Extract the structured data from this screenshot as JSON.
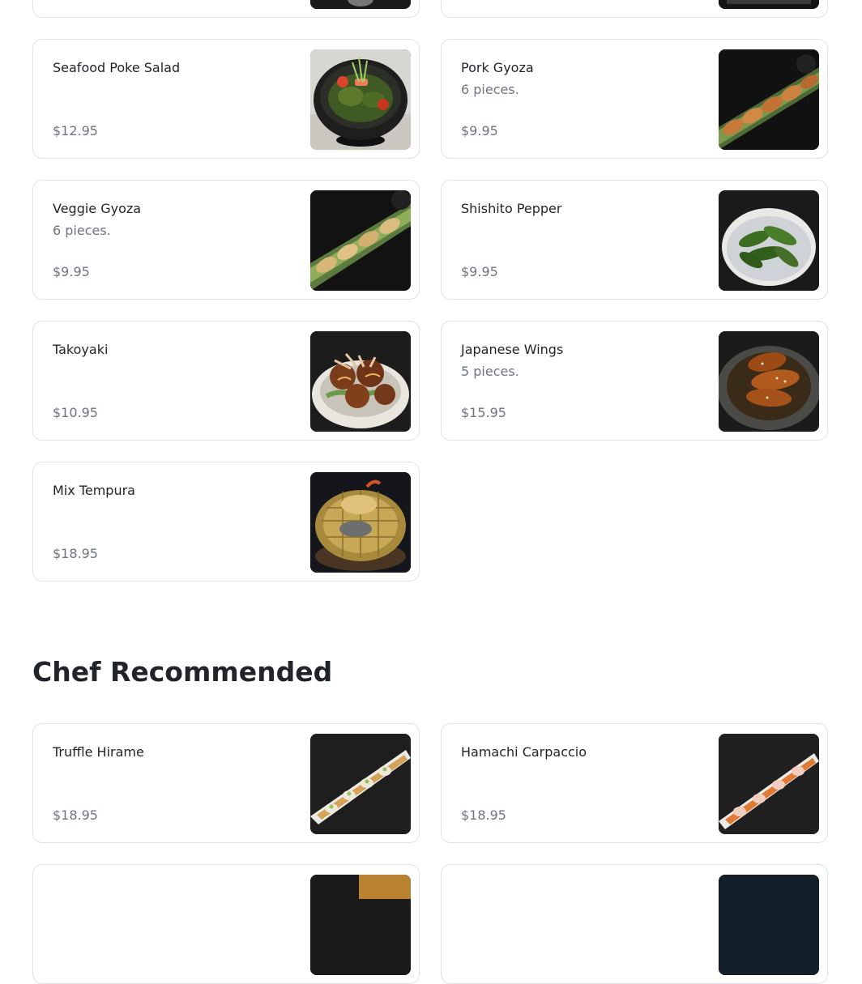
{
  "top_cards": [
    {
      "name": "",
      "price": ""
    },
    {
      "name": "",
      "price": ""
    }
  ],
  "previous_section": {
    "items": [
      {
        "name": "Seafood Poke Salad",
        "description": "",
        "price": "$12.95",
        "image": "poke-salad-photo"
      },
      {
        "name": "Pork Gyoza",
        "description": "6 pieces.",
        "price": "$9.95",
        "image": "pork-gyoza-photo"
      },
      {
        "name": "Veggie Gyoza",
        "description": "6 pieces.",
        "price": "$9.95",
        "image": "veggie-gyoza-photo"
      },
      {
        "name": "Shishito Pepper",
        "description": "",
        "price": "$9.95",
        "image": "shishito-pepper-photo"
      },
      {
        "name": "Takoyaki",
        "description": "",
        "price": "$10.95",
        "image": "takoyaki-photo"
      },
      {
        "name": "Japanese Wings",
        "description": "5 pieces.",
        "price": "$15.95",
        "image": "japanese-wings-photo"
      },
      {
        "name": "Mix Tempura",
        "description": "",
        "price": "$18.95",
        "image": "mix-tempura-photo"
      }
    ]
  },
  "chef_recommended": {
    "title": "Chef Recommended",
    "items": [
      {
        "name": "Truffle Hirame",
        "description": "",
        "price": "$18.95",
        "image": "truffle-hirame-photo"
      },
      {
        "name": "Hamachi Carpaccio",
        "description": "",
        "price": "$18.95",
        "image": "hamachi-carpaccio-photo"
      },
      {
        "name": "",
        "description": "",
        "price": "",
        "image": "partial-item-photo"
      },
      {
        "name": "",
        "description": "",
        "price": "",
        "image": "partial-item-photo"
      }
    ]
  }
}
